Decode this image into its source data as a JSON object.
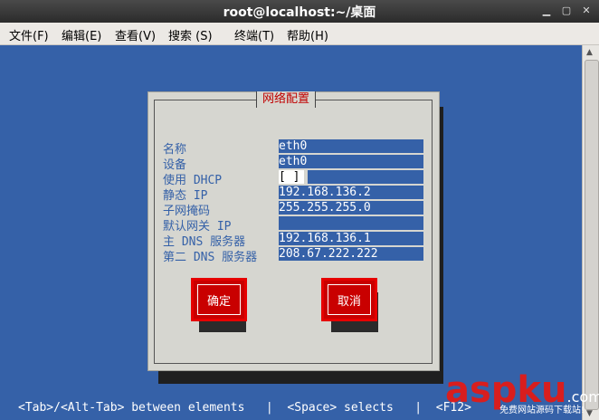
{
  "window": {
    "title": "root@localhost:~/桌面"
  },
  "menu": [
    {
      "label": "文件(F)"
    },
    {
      "label": "编辑(E)"
    },
    {
      "label": "查看(V)"
    },
    {
      "label": "搜索 (S)"
    },
    {
      "label": "终端(T)"
    },
    {
      "label": "帮助(H)"
    }
  ],
  "dialog": {
    "title": "网络配置",
    "fields": [
      {
        "label": "名称",
        "value": "eth0"
      },
      {
        "label": "设备",
        "value": "eth0"
      },
      {
        "label": "使用 DHCP",
        "value": "[ ]"
      },
      {
        "label": "静态 IP",
        "value": "192.168.136.2"
      },
      {
        "label": "子网掩码",
        "value": "255.255.255.0"
      },
      {
        "label": "默认网关 IP",
        "value": ""
      },
      {
        "label": "主 DNS 服务器",
        "value": "192.168.136.1"
      },
      {
        "label": "第二 DNS 服务器",
        "value": "208.67.222.222"
      }
    ],
    "ok_label": "确定",
    "cancel_label": "取消"
  },
  "status_bar": "<Tab>/<Alt-Tab> between elements   |  <Space> selects   |  <F12>",
  "watermark": {
    "text": "aspku",
    "suffix": ".com",
    "sub": "免费网站源码下载站!"
  }
}
